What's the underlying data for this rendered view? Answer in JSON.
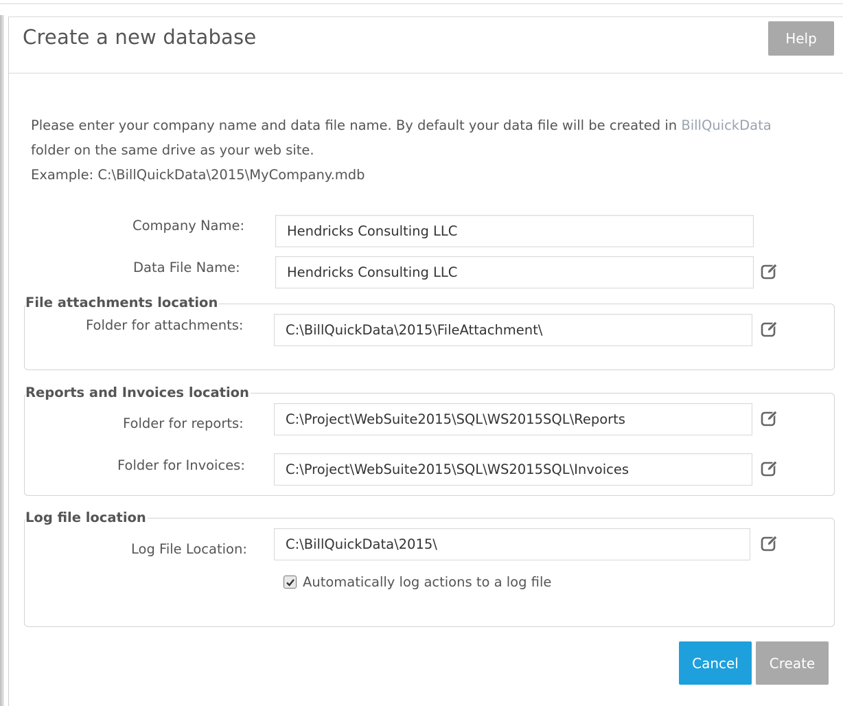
{
  "dialog": {
    "title": "Create a new database",
    "help_label": "Help"
  },
  "description": {
    "line1": "Please enter your company name and data file name. By default your data file will be created in ",
    "link": "BillQuickData",
    "line2": "folder on the same drive as your web site.",
    "example": "Example: C:\\BillQuickData\\2015\\MyCompany.mdb"
  },
  "company": {
    "label": "Company Name:",
    "value": "Hendricks Consulting LLC"
  },
  "datafile": {
    "label": "Data File Name:",
    "value": "Hendricks Consulting LLC"
  },
  "attachments": {
    "legend": "File attachments location",
    "label": "Folder for attachments:",
    "value": "C:\\BillQuickData\\2015\\FileAttachment\\"
  },
  "reports": {
    "legend": "Reports and Invoices location",
    "reports_label": "Folder for reports:",
    "reports_value": "C:\\Project\\WebSuite2015\\SQL\\WS2015SQL\\Reports",
    "invoices_label": "Folder for Invoices:",
    "invoices_value": "C:\\Project\\WebSuite2015\\SQL\\WS2015SQL\\Invoices"
  },
  "log": {
    "legend": "Log file location",
    "label": "Log File Location:",
    "value": "C:\\BillQuickData\\2015\\",
    "auto_log_label": "Automatically log actions to a log file",
    "auto_log_checked": true
  },
  "footer": {
    "cancel_label": "Cancel",
    "create_label": "Create"
  },
  "colors": {
    "primary": "#1ea0dc",
    "disabled": "#a9a9a9",
    "link": "#9aa3b0"
  },
  "icons": {
    "edit": "edit-icon",
    "checkbox": "check-icon"
  }
}
